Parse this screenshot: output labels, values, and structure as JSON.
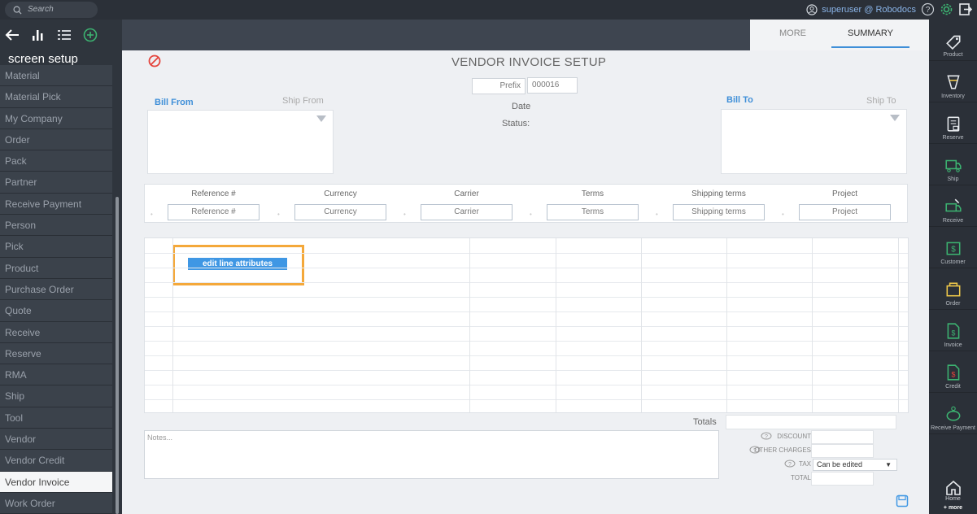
{
  "topbar": {
    "search_placeholder": "Search",
    "user_label": "superuser @ Robodocs"
  },
  "sidebar": {
    "title": "screen setup",
    "items": [
      {
        "label": "Material"
      },
      {
        "label": "Material Pick"
      },
      {
        "label": "My Company"
      },
      {
        "label": "Order"
      },
      {
        "label": "Pack"
      },
      {
        "label": "Partner"
      },
      {
        "label": "Receive Payment"
      },
      {
        "label": "Person"
      },
      {
        "label": "Pick"
      },
      {
        "label": "Product"
      },
      {
        "label": "Purchase Order"
      },
      {
        "label": "Quote"
      },
      {
        "label": "Receive"
      },
      {
        "label": "Reserve"
      },
      {
        "label": "RMA"
      },
      {
        "label": "Ship"
      },
      {
        "label": "Tool"
      },
      {
        "label": "Vendor"
      },
      {
        "label": "Vendor Credit"
      },
      {
        "label": "Vendor Invoice"
      },
      {
        "label": "Work Order"
      }
    ],
    "active_index": 19
  },
  "tabs": {
    "more": "MORE",
    "summary": "SUMMARY"
  },
  "form": {
    "title": "VENDOR INVOICE SETUP",
    "prefix_label": "Prefix",
    "prefix_value": "000016",
    "date_label": "Date",
    "status_label": "Status:",
    "bill_from": "Bill From",
    "ship_from": "Ship From",
    "bill_to": "Bill To",
    "ship_to": "Ship To"
  },
  "reference_fields": [
    {
      "header": "Reference #",
      "placeholder": "Reference #"
    },
    {
      "header": "Currency",
      "placeholder": "Currency"
    },
    {
      "header": "Carrier",
      "placeholder": "Carrier"
    },
    {
      "header": "Terms",
      "placeholder": "Terms"
    },
    {
      "header": "Shipping terms",
      "placeholder": "Shipping terms"
    },
    {
      "header": "Project",
      "placeholder": "Project"
    }
  ],
  "lines": {
    "edit_button": "edit line attributes"
  },
  "summary": {
    "totals": "Totals",
    "notes_placeholder": "Notes...",
    "discount": "DISCOUNT",
    "other_charges": "OTHER CHARGES",
    "tax": "TAX",
    "tax_option": "Can be edited",
    "total": "TOTAL"
  },
  "rightbar": {
    "items": [
      {
        "label": "Product",
        "icon": "tag-icon"
      },
      {
        "label": "Inventory",
        "icon": "inventory-icon"
      },
      {
        "label": "Reserve",
        "icon": "reserve-icon"
      },
      {
        "label": "Ship",
        "icon": "ship-icon"
      },
      {
        "label": "Receive",
        "icon": "receive-icon"
      },
      {
        "label": "Customer",
        "icon": "customer-icon"
      },
      {
        "label": "Order",
        "icon": "order-icon"
      },
      {
        "label": "Invoice",
        "icon": "invoice-icon"
      },
      {
        "label": "Credit",
        "icon": "credit-icon"
      },
      {
        "label": "Receive Payment",
        "icon": "piggy-bank-icon"
      }
    ],
    "home_label": "Home",
    "more_label": "+ more"
  },
  "colors": {
    "accent": "#3f8fd8",
    "highlight": "#f4a83a",
    "green": "#3cb371"
  }
}
